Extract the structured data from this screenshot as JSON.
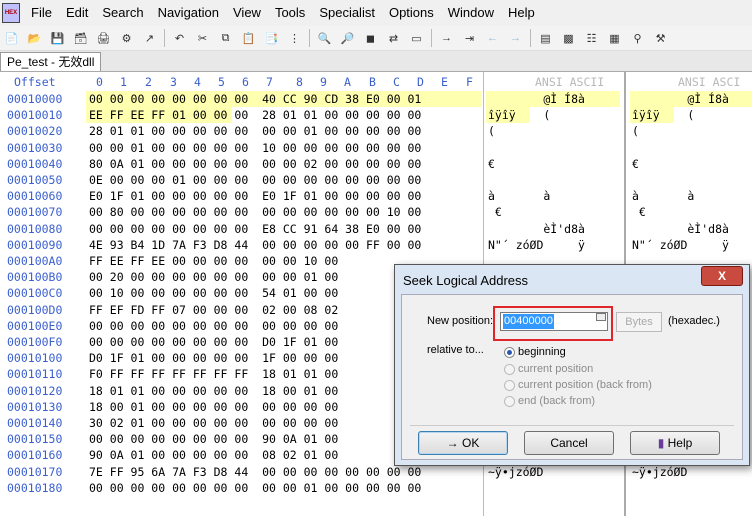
{
  "menu": [
    "File",
    "Edit",
    "Search",
    "Navigation",
    "View",
    "Tools",
    "Specialist",
    "Options",
    "Window",
    "Help"
  ],
  "logo_text": "HEX",
  "tab_title": "Pe_test - 无效dll",
  "header": {
    "offset": "Offset",
    "cols": [
      "0",
      "1",
      "2",
      "3",
      "4",
      "5",
      "6",
      "7",
      "8",
      "9",
      "A",
      "B",
      "C",
      "D",
      "E",
      "F"
    ],
    "ansi1": "ANSI ASCII",
    "ansi2": "ANSI ASCI"
  },
  "rows": [
    {
      "off": "00010000",
      "hex": "00 00 00 00 00 00 00 00  40 CC 90 CD 38 E0 00 01",
      "asc": "        @Ì Í8à"
    },
    {
      "off": "00010010",
      "hex": "EE FF EE FF 01 00 00 00  28 01 01 00 00 00 00 00",
      "asc": "îÿîÿ    ("
    },
    {
      "off": "00010020",
      "hex": "28 01 01 00 00 00 00 00  00 00 01 00 00 00 00 00",
      "asc": "("
    },
    {
      "off": "00010030",
      "hex": "00 00 01 00 00 00 00 00  10 00 00 00 00 00 00 00",
      "asc": ""
    },
    {
      "off": "00010040",
      "hex": "80 0A 01 00 00 00 00 00  00 00 02 00 00 00 00 00",
      "asc": "€"
    },
    {
      "off": "00010050",
      "hex": "0E 00 00 00 01 00 00 00  00 00 00 00 00 00 00 00",
      "asc": ""
    },
    {
      "off": "00010060",
      "hex": "E0 1F 01 00 00 00 00 00  E0 1F 01 00 00 00 00 00",
      "asc": "à       à"
    },
    {
      "off": "00010070",
      "hex": "00 80 00 00 00 00 00 00  00 00 00 00 00 00 10 00",
      "asc": " €"
    },
    {
      "off": "00010080",
      "hex": "00 00 00 00 00 00 00 00  E8 CC 91 64 38 E0 00 00",
      "asc": "        èÌ'd8à"
    },
    {
      "off": "00010090",
      "hex": "4E 93 B4 1D 7A F3 D8 44  00 00 00 00 00 FF 00 00",
      "asc": "N\"´ zóØD     ÿ"
    },
    {
      "off": "000100A0",
      "hex": "FF EE FF EE 00 00 00 00  00 00 10 00",
      "asc": ""
    },
    {
      "off": "000100B0",
      "hex": "00 20 00 00 00 00 00 00  00 00 01 00",
      "asc": ""
    },
    {
      "off": "000100C0",
      "hex": "00 10 00 00 00 00 00 00  54 01 00 00",
      "asc": ""
    },
    {
      "off": "000100D0",
      "hex": "FF EF FD FF 07 00 00 00  02 00 08 02",
      "asc": ""
    },
    {
      "off": "000100E0",
      "hex": "00 00 00 00 00 00 00 00  00 00 00 00",
      "asc": ""
    },
    {
      "off": "000100F0",
      "hex": "00 00 00 00 00 00 00 00  D0 1F 01 00",
      "asc": ""
    },
    {
      "off": "00010100",
      "hex": "D0 1F 01 00 00 00 00 00  1F 00 00 00",
      "asc": ""
    },
    {
      "off": "00010110",
      "hex": "F0 FF FF FF FF FF FF FF  18 01 01 00",
      "asc": ""
    },
    {
      "off": "00010120",
      "hex": "18 01 01 00 00 00 00 00  18 00 01 00",
      "asc": ""
    },
    {
      "off": "00010130",
      "hex": "18 00 01 00 00 00 00 00  00 00 00 00",
      "asc": ""
    },
    {
      "off": "00010140",
      "hex": "30 02 01 00 00 00 00 00  00 00 00 00",
      "asc": ""
    },
    {
      "off": "00010150",
      "hex": "00 00 00 00 00 00 00 00  90 0A 01 00",
      "asc": ""
    },
    {
      "off": "00010160",
      "hex": "90 0A 01 00 00 00 00 00  08 02 01 00",
      "asc": ""
    },
    {
      "off": "00010170",
      "hex": "7E FF 95 6A 7A F3 D8 44  00 00 00 00 00 00 00 00",
      "asc": "~ÿ•jzóØD"
    },
    {
      "off": "00010180",
      "hex": "00 00 00 00 00 00 00 00  00 00 01 00 00 00 00 00",
      "asc": ""
    }
  ],
  "dialog": {
    "title": "Seek Logical Address",
    "close": "X",
    "new_position_label": "New position:",
    "position_value": "00400000",
    "unit_button": "Bytes",
    "hexadec_label": "(hexadec.)",
    "relative_label": "relative to...",
    "options": [
      "beginning",
      "current position",
      "current position (back from)",
      "end (back from)"
    ],
    "selected_option": "beginning",
    "ok": "OK",
    "cancel": "Cancel",
    "help": "Help"
  }
}
